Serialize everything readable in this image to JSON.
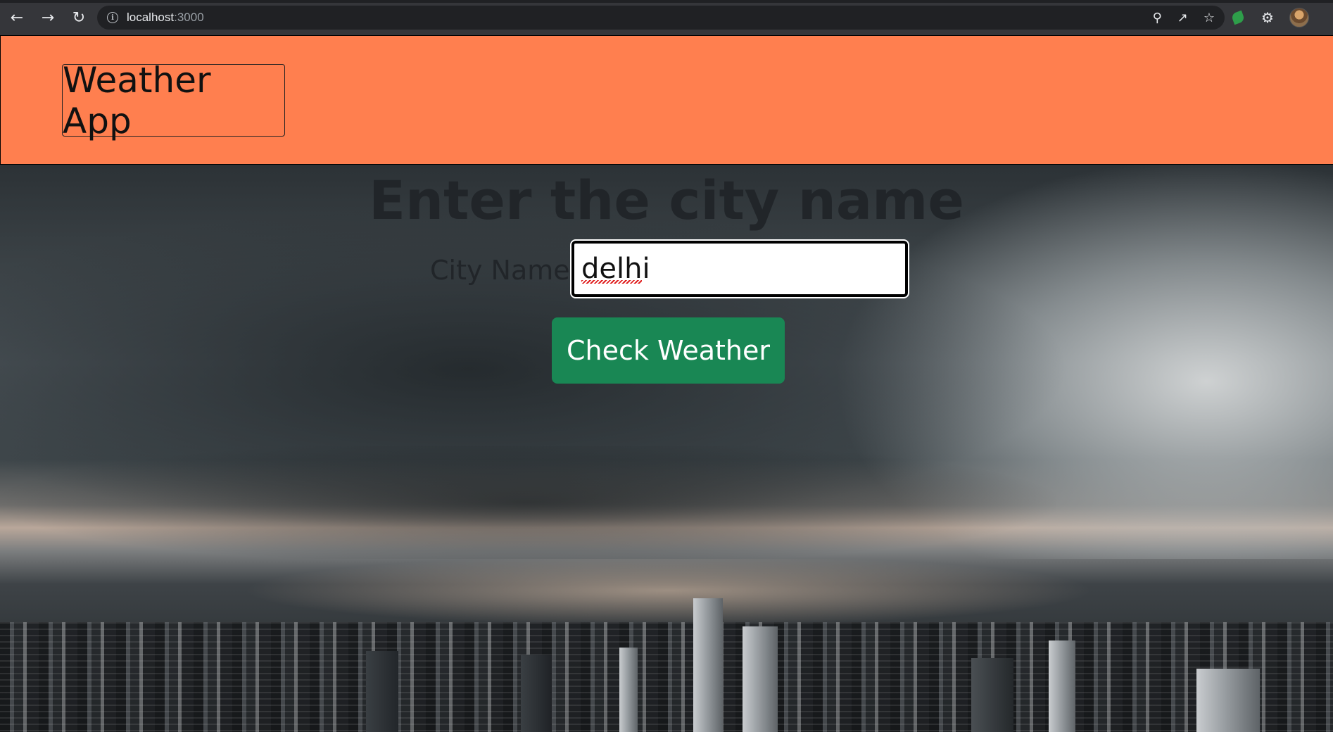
{
  "browser": {
    "url_host": "localhost",
    "url_port": ":3000",
    "icons": {
      "back": "arrow-left-icon",
      "forward": "arrow-right-icon",
      "reload": "reload-icon",
      "site_info": "info-icon",
      "zoom": "zoom-icon",
      "share": "share-icon",
      "bookmark": "star-icon",
      "extension": "leaf-extension-icon",
      "extensions_menu": "puzzle-icon",
      "profile": "avatar",
      "menu": "kebab-menu-icon"
    }
  },
  "header": {
    "brand": "Weather App",
    "background_color": "#ff7f4f"
  },
  "main": {
    "heading": "Enter the city name",
    "form": {
      "label": "City Name:",
      "input_value": "delhi",
      "button_label": "Check Weather",
      "button_color": "#198754"
    }
  }
}
